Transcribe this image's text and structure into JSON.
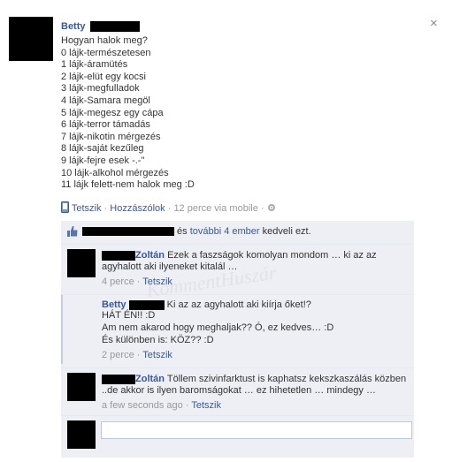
{
  "post": {
    "author": "Betty",
    "lines": [
      "Hogyan halok meg?",
      "0 lájk-természetesen",
      "1 lájk-áramütés",
      "2 lájk-elüt egy kocsi",
      "3 lájk-megfulladok",
      "4 lájk-Samara megöl",
      "5 lájk-megesz egy cápa",
      "6 lájk-terror támadás",
      "7 lájk-nikotin mérgezés",
      "8 lájk-saját kezűleg",
      "9 lájk-fejre esek -.-\"",
      "10 lájk-alkohol mérgezés",
      "11 lájk felett-nem halok meg :D"
    ],
    "actions": {
      "like": "Tetszik",
      "comment": "Hozzászólok",
      "time": "12 perce via mobile",
      "separator": "·"
    },
    "close_glyph": "×"
  },
  "likes": {
    "text_and": "és",
    "others_link": "további 4 ember",
    "text_suffix": "kedveli ezt."
  },
  "comments": [
    {
      "author": "Zoltán",
      "lines": [
        "Ezek a faszságok komolyan mondom … ki az az",
        "agyhalott aki ilyeneket kitalál …"
      ],
      "time": "4 perce",
      "like": "Tetszik"
    },
    {
      "author": "Betty",
      "inline": "Ki az az agyhalott aki kiírja őket!?",
      "lines": [
        "HÁT ÉN!! :D",
        "Am nem akarod hogy meghaljak?? Ó, ez kedves… :D",
        "És különben is: KÖZ?? :D"
      ],
      "time": "2 perce",
      "like": "Tetszik"
    },
    {
      "author": "Zoltán",
      "lines": [
        "Töllem szivinfarktust is kaphatsz kekszkaszálás közben",
        "..de akkor is ilyen baromságokat … ez hihetetlen … mindegy …"
      ],
      "time": "a few seconds ago",
      "like": "Tetszik"
    }
  ],
  "composer": {
    "placeholder": ""
  },
  "watermark": "KommentHuszár",
  "icons": {
    "mobile": "mobile-phone-icon",
    "settings": "gear-icon",
    "like": "thumbs-up-icon",
    "close": "close-icon"
  }
}
